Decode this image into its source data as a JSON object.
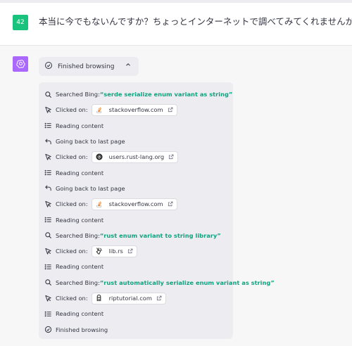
{
  "user": {
    "avatar_label": "42",
    "message": "本当に今でもないんですか？ちょっとインターネットで調べてみてくれませんか？"
  },
  "assistant": {
    "toggle_label": "Finished browsing",
    "log": [
      {
        "type": "search",
        "icon": "search-icon",
        "prefix": "Searched Bing: ",
        "query": "“serde serialize enum variant as string”"
      },
      {
        "type": "click",
        "icon": "cursor-icon",
        "prefix": "Clicked on:",
        "site": "stackoverflow.com",
        "site_icon": "stackoverflow-icon"
      },
      {
        "type": "text",
        "icon": "list-icon",
        "text": "Reading content"
      },
      {
        "type": "text",
        "icon": "back-arrow-icon",
        "text": "Going back to last page"
      },
      {
        "type": "click",
        "icon": "cursor-icon",
        "prefix": "Clicked on:",
        "site": "users.rust-lang.org",
        "site_icon": "rust-icon"
      },
      {
        "type": "text",
        "icon": "list-icon",
        "text": "Reading content"
      },
      {
        "type": "text",
        "icon": "back-arrow-icon",
        "text": "Going back to last page"
      },
      {
        "type": "click",
        "icon": "cursor-icon",
        "prefix": "Clicked on:",
        "site": "stackoverflow.com",
        "site_icon": "stackoverflow-icon"
      },
      {
        "type": "text",
        "icon": "list-icon",
        "text": "Reading content"
      },
      {
        "type": "search",
        "icon": "search-icon",
        "prefix": "Searched Bing: ",
        "query": "“rust enum variant to string library”"
      },
      {
        "type": "click",
        "icon": "cursor-icon",
        "prefix": "Clicked on:",
        "site": "lib.rs",
        "site_icon": "librs-icon"
      },
      {
        "type": "text",
        "icon": "list-icon",
        "text": "Reading content"
      },
      {
        "type": "search",
        "icon": "search-icon",
        "prefix": "Searched Bing: ",
        "query": "“rust automatically serialize enum variant as string”"
      },
      {
        "type": "click",
        "icon": "cursor-icon",
        "prefix": "Clicked on:",
        "site": "riptutorial.com",
        "site_icon": "riptutorial-icon"
      },
      {
        "type": "text",
        "icon": "list-icon",
        "text": "Reading content"
      },
      {
        "type": "text",
        "icon": "check-circle-icon",
        "text": "Finished browsing"
      }
    ]
  },
  "colors": {
    "user_avatar": "#19c37d",
    "gpt_avatar": "#ab68ff",
    "query_green": "#10a37f",
    "panel_bg": "#ececf1"
  }
}
